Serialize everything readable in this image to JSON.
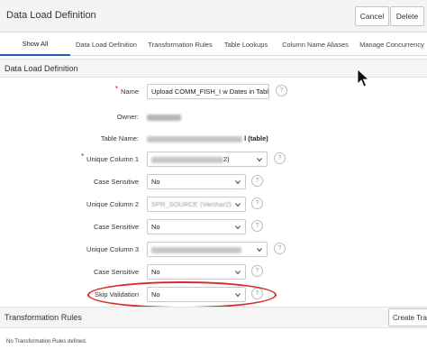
{
  "header": {
    "title": "Data Load Definition",
    "cancel_label": "Cancel",
    "delete_label": "Delete"
  },
  "tabs": [
    {
      "label": "Show All",
      "active": true
    },
    {
      "label": "Data Load Definition"
    },
    {
      "label": "Transformation Rules"
    },
    {
      "label": "Table Lookups"
    },
    {
      "label": "Column Name Aliases"
    },
    {
      "label": "Manage Concurrency"
    }
  ],
  "definition_region": {
    "title": "Data Load Definition",
    "name": {
      "label": "Name",
      "value": "Upload COMM_FISH_I w Dates in Table"
    },
    "owner": {
      "label": "Owner:"
    },
    "table_name": {
      "label": "Table Name:",
      "suffix": "l (table)"
    },
    "unique_column_1": {
      "label": "Unique Column 1",
      "value_suffix": "2)"
    },
    "case_sensitive_1": {
      "label": "Case Sensitive",
      "value": "No"
    },
    "unique_column_2": {
      "label": "Unique Column 2",
      "value": "SPR_SOURCE (Varchar2)"
    },
    "case_sensitive_2": {
      "label": "Case Sensitive",
      "value": "No"
    },
    "unique_column_3": {
      "label": "Unique Column 3"
    },
    "case_sensitive_3": {
      "label": "Case Sensitive",
      "value": "No"
    },
    "skip_validation": {
      "label": "Skip Validation",
      "value": "No"
    },
    "help_glyph": "?"
  },
  "transformation_region": {
    "title": "Transformation Rules",
    "create_label": "Create Tra",
    "empty_message": "No Transformation Rules defined."
  },
  "colors": {
    "required": "#d0021b",
    "highlight": "#d42a2a",
    "tab_active": "#1a5fb4"
  }
}
